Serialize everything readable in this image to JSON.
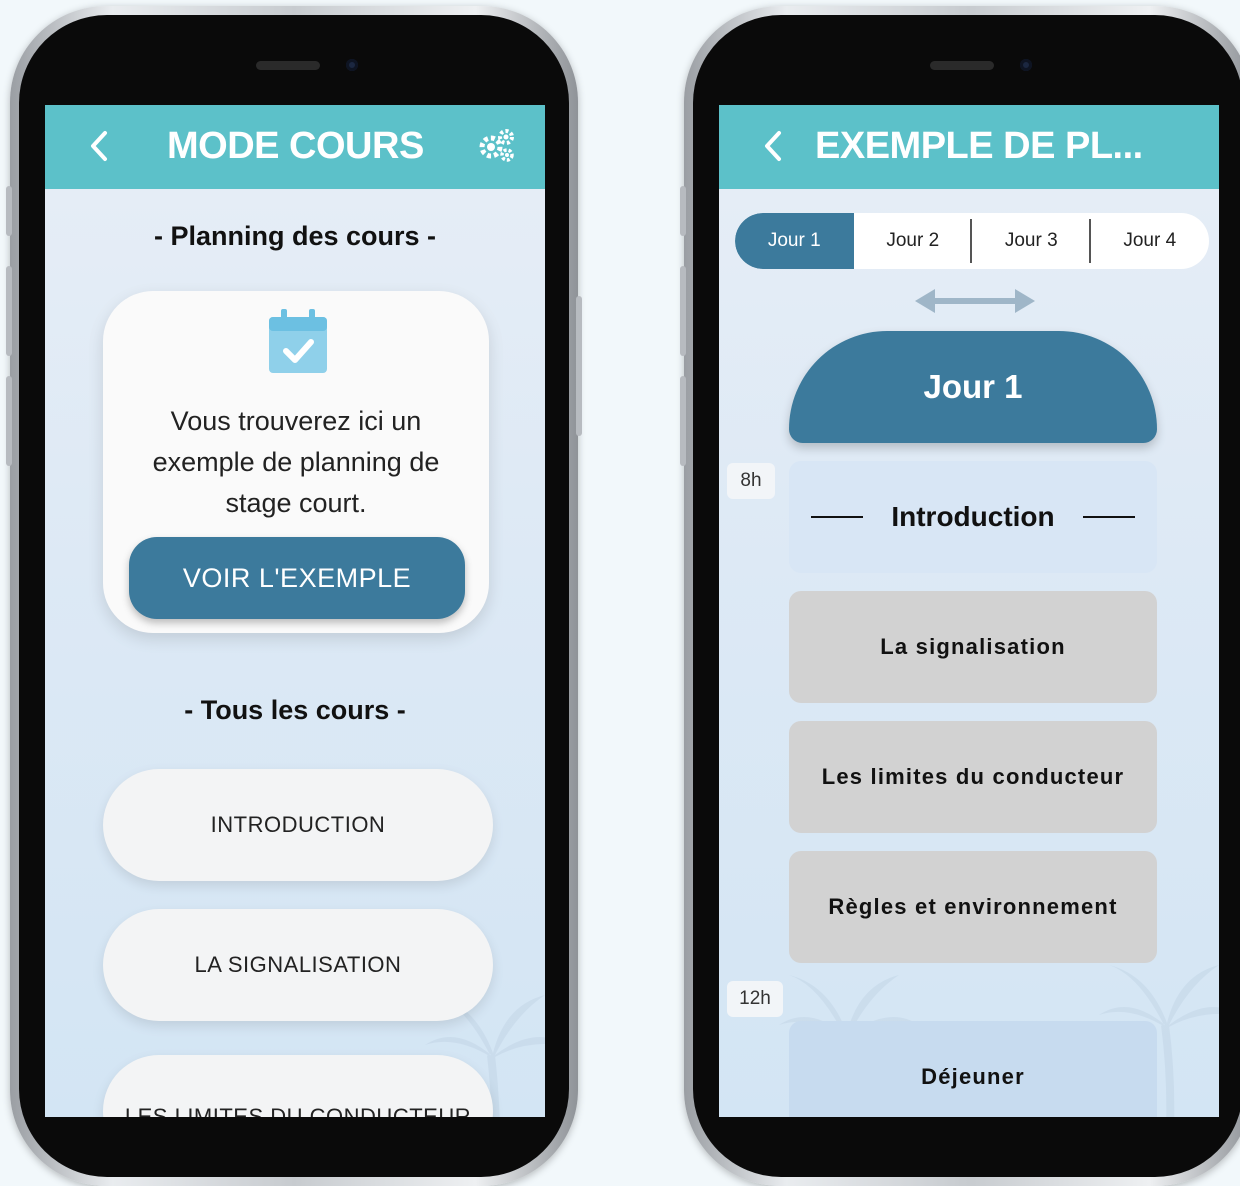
{
  "screen_left": {
    "header": {
      "title": "MODE COURS",
      "back_icon": "chevron-left-icon",
      "settings_icon": "gears-icon"
    },
    "planning_section_title": "- Planning des cours -",
    "planning_card": {
      "icon": "calendar-check-icon",
      "description": "Vous trouverez ici un exemple de planning de stage court.",
      "button_label": "VOIR L'EXEMPLE"
    },
    "courses_section_title": "- Tous les cours -",
    "courses": [
      "INTRODUCTION",
      "LA SIGNALISATION",
      "LES LIMITES DU CONDUCTEUR"
    ]
  },
  "screen_right": {
    "header": {
      "title": "EXEMPLE DE PL...",
      "back_icon": "chevron-left-icon"
    },
    "tabs": [
      "Jour 1",
      "Jour 2",
      "Jour 3",
      "Jour 4"
    ],
    "active_tab": "Jour 1",
    "day_title": "Jour 1",
    "hours": [
      "8h",
      "12h"
    ],
    "slots": [
      "Introduction",
      "La signalisation",
      "Les limites du conducteur",
      "Règles et environnement",
      "Déjeuner"
    ]
  },
  "colors": {
    "header": "#5cc1c9",
    "accent": "#3c7a9c",
    "slot_grey": "#d2d2d2",
    "slot_light": "#c7dbef"
  }
}
